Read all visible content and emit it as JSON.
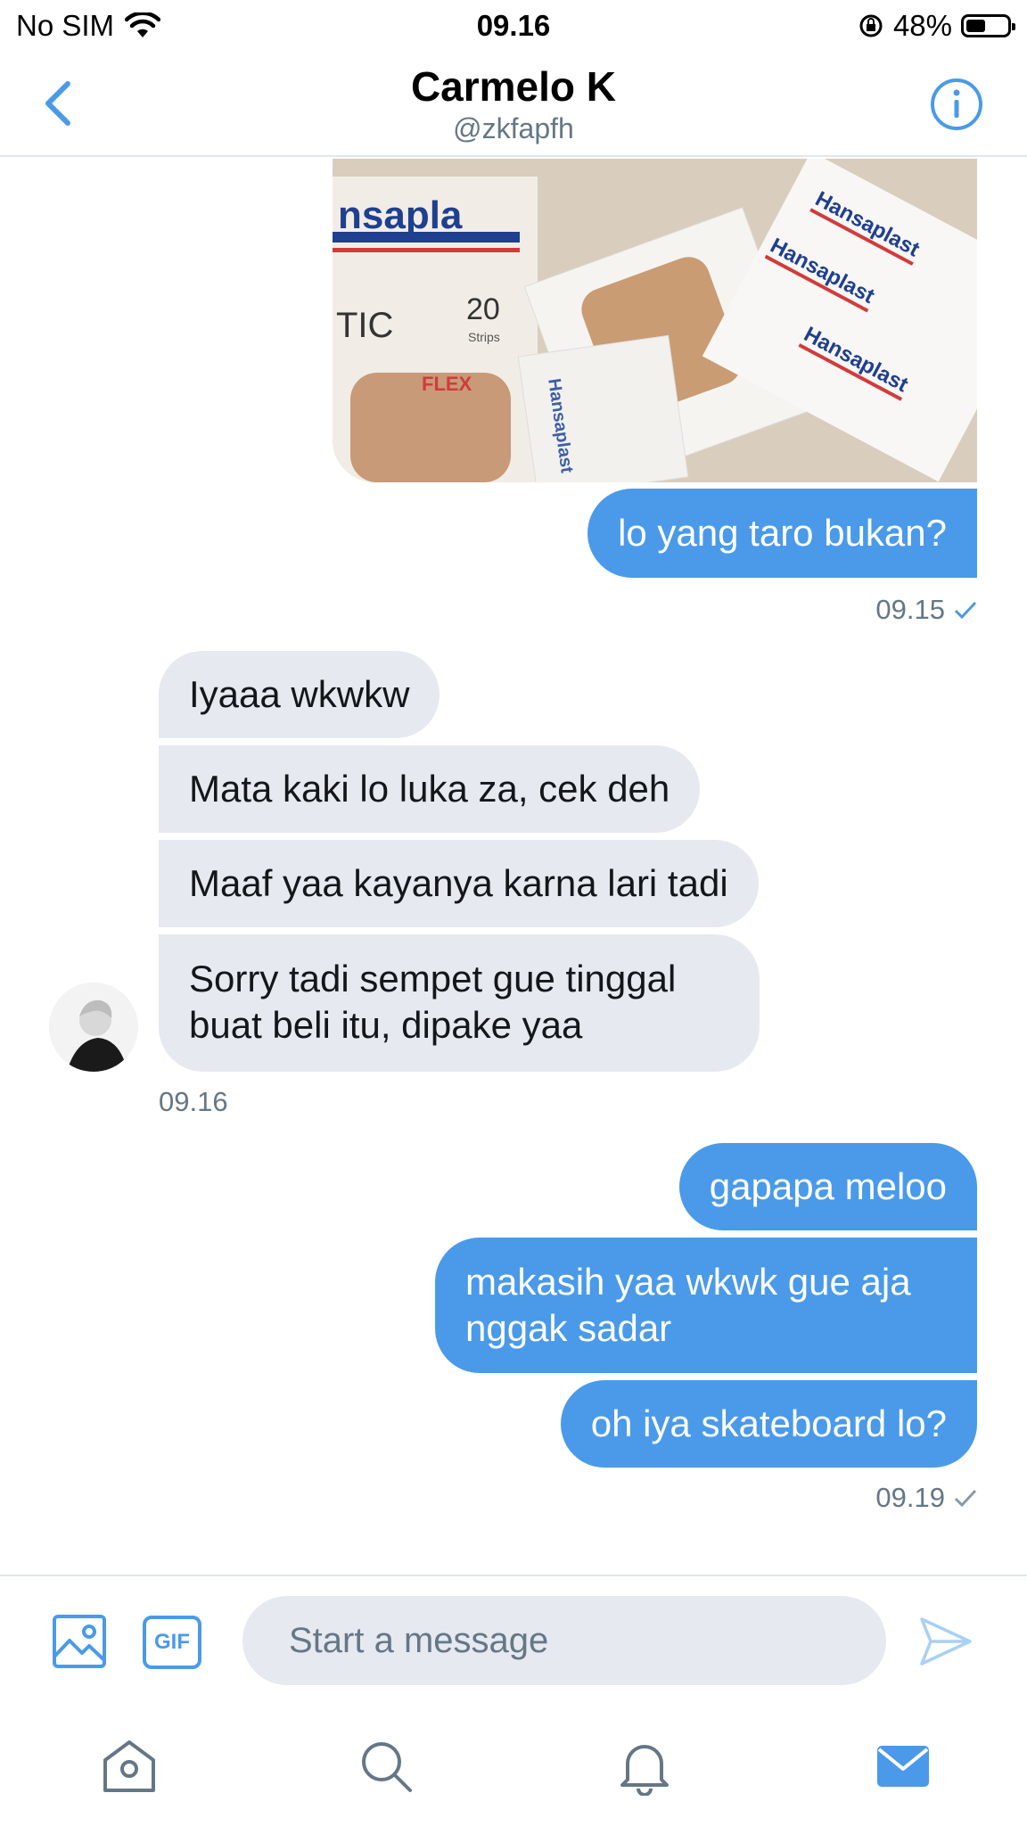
{
  "status_bar": {
    "carrier": "No SIM",
    "time": "09.16",
    "battery": "48%",
    "battery_level": 0.48
  },
  "header": {
    "title": "Carmelo K",
    "handle": "@zkfapfh"
  },
  "messages": {
    "sent_1": {
      "text": "lo yang taro bukan?",
      "time": "09.15"
    },
    "recv_1": {
      "text": "Iyaaa wkwkw"
    },
    "recv_2": {
      "text": "Mata kaki lo luka za, cek deh"
    },
    "recv_3": {
      "text": "Maaf yaa kayanya karna lari tadi"
    },
    "recv_4": {
      "line1": "Sorry tadi sempet gue tinggal",
      "line2": "buat beli itu, dipake yaa",
      "time": "09.16"
    },
    "sent_2": {
      "text": "gapapa meloo"
    },
    "sent_3": {
      "line1": "makasih yaa wkwk gue aja",
      "line2": "nggak sadar"
    },
    "sent_4": {
      "text": "oh iya skateboard lo?",
      "time": "09.19"
    }
  },
  "photo": {
    "brand_text": "Hansaplast",
    "box_text_1": "nsapla",
    "box_text_2": "TIC",
    "box_text_3": "20",
    "box_text_4": "Strips",
    "flex_label": "FLEX"
  },
  "composer": {
    "placeholder": "Start a message",
    "gif_label": "GIF"
  },
  "colors": {
    "accent": "#4a9ae9",
    "received_bubble": "#e6e9ef",
    "muted": "#657786"
  }
}
